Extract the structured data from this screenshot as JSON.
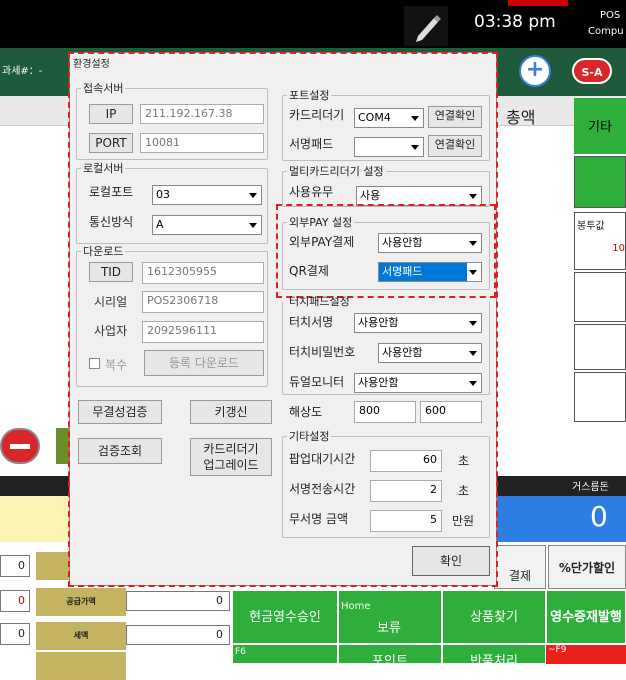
{
  "topbar": {
    "time": "03:38 pm",
    "brand_line1": "POS",
    "brand_line2": "Compu",
    "tax_label": "과세#：-"
  },
  "toolbar": {
    "plus_label": "+",
    "sa_label": "S-A"
  },
  "main": {
    "total_header": "총액",
    "gita_label": "기타",
    "tongtu_label": "봉투값",
    "tongtu_value": "10",
    "change_label": "거스름돈",
    "change_value": "0"
  },
  "left_rows": [
    "0",
    "0",
    "0"
  ],
  "amount_rows": [
    {
      "label": "공급가액",
      "value": "0"
    },
    {
      "label": "세액",
      "value": "0"
    }
  ],
  "func_buttons": {
    "cash_receipt": "현금영수승인",
    "hold_key": "Home",
    "hold": "보류",
    "find_product": "상품찾기",
    "reissue": "영수증재발행",
    "f6": "F6",
    "point": "포인트",
    "return": "반품처리",
    "f9": "~F9",
    "pay": "결제",
    "pct_discount": "%단가할인"
  },
  "dialog": {
    "title": "환경설정",
    "server": {
      "legend": "접속서버",
      "ip_button": "IP",
      "ip_value": "211.192.167.38",
      "port_button": "PORT",
      "port_value": "10081"
    },
    "local_server": {
      "legend": "로컬서버",
      "port_label": "로컬포트",
      "port_value": "03",
      "comm_label": "통신방식",
      "comm_value": "A"
    },
    "download": {
      "legend": "다운로드",
      "tid_button": "TID",
      "tid_value": "1612305955",
      "serial_label": "시리얼",
      "serial_value": "POS2306718",
      "biz_label": "사업자",
      "biz_value": "2092596111",
      "multi_label": "복수",
      "register_button": "등록 다운로드"
    },
    "integrity_button": "무결성검증",
    "key_renew_button": "키갱신",
    "verify_query_button": "검증조회",
    "card_upgrade_button_line1": "카드리더기",
    "card_upgrade_button_line2": "업그레이드",
    "port_settings": {
      "legend": "포트설정",
      "card_reader_label": "카드리더기",
      "card_reader_value": "COM4",
      "card_reader_check": "연결확인",
      "sign_pad_label": "서명패드",
      "sign_pad_value": "",
      "sign_pad_check": "연결확인"
    },
    "multi_card": {
      "legend": "멀티카드리더기 설정",
      "use_label": "사용유무",
      "use_value": "사용"
    },
    "external_pay": {
      "legend": "외부PAY 설정",
      "pay_label": "외부PAY결제",
      "pay_value": "사용안함",
      "qr_label": "QR결제",
      "qr_value": "서명패드"
    },
    "touch_pad": {
      "legend": "터치패드설정",
      "sign_label": "터치서명",
      "sign_value": "사용안함",
      "pin_label": "터치비밀번호",
      "pin_value": "사용안함",
      "dual_label": "듀얼모니터",
      "dual_value": "사용안함"
    },
    "resolution_label": "해상도",
    "resolution_w": "800",
    "resolution_h": "600",
    "etc": {
      "legend": "기타설정",
      "popup_label": "팝업대기시간",
      "popup_value": "60",
      "popup_unit": "초",
      "sign_tx_label": "서명전송시간",
      "sign_tx_value": "2",
      "sign_tx_unit": "초",
      "nosign_label": "무서명 금액",
      "nosign_value": "5",
      "nosign_unit": "만원"
    },
    "ok_button": "확인"
  }
}
